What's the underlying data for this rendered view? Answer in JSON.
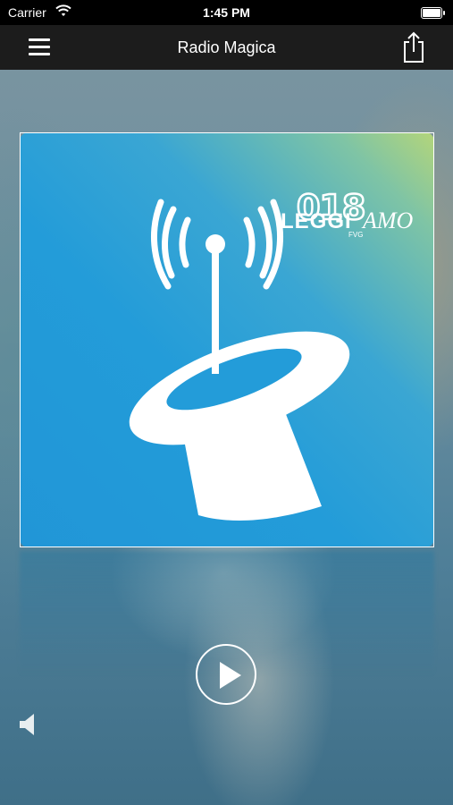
{
  "status_bar": {
    "carrier": "Carrier",
    "time": "1:45 PM"
  },
  "nav": {
    "title": "Radio Magica",
    "menu_icon": "hamburger-menu-icon",
    "share_icon": "share-icon"
  },
  "artwork": {
    "logo_number": "018",
    "logo_word_a": "LEGGI",
    "logo_word_b": "AMO",
    "logo_region": "FVG",
    "background_color": "#239cd9"
  },
  "player": {
    "play_icon": "play-icon",
    "volume_icon": "speaker-icon"
  }
}
